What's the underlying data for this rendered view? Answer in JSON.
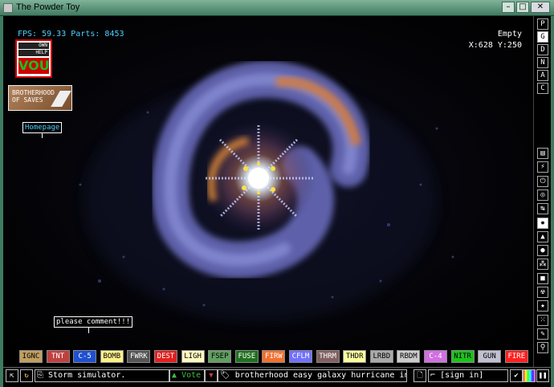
{
  "window": {
    "title": "The Powder Toy",
    "min_glyph": "–",
    "max_glyph": "□",
    "close_glyph": "✕"
  },
  "hud": {
    "fps_label": "FPS:",
    "fps_value": "59.33",
    "parts_label": "Parts:",
    "parts_value": "8453",
    "hover_element": "Empty",
    "coords": "X:628 Y:250"
  },
  "signs": {
    "homepage": "Homepage",
    "comment": "please comment!!!"
  },
  "vote_badge": {
    "line1": "OWN",
    "line2": "HELP",
    "line3": "VOU"
  },
  "brotherhood_logo": {
    "text": "BROTHERHOOD\nOF SAVES"
  },
  "right_toolbar": {
    "menu": [
      {
        "label": "P",
        "active": false
      },
      {
        "label": "G",
        "active": true
      },
      {
        "label": "D",
        "active": false
      },
      {
        "label": "N",
        "active": false
      },
      {
        "label": "A",
        "active": false
      },
      {
        "label": "C",
        "active": false
      }
    ],
    "categories": [
      {
        "icon": "walls-icon",
        "glyph": "▤"
      },
      {
        "icon": "electronics-icon",
        "glyph": "⚡"
      },
      {
        "icon": "powered-icon",
        "glyph": "⏻"
      },
      {
        "icon": "sensors-icon",
        "glyph": "◎"
      },
      {
        "icon": "force-icon",
        "glyph": "↹"
      },
      {
        "icon": "explosives-icon",
        "glyph": "✸",
        "active": true
      },
      {
        "icon": "gases-icon",
        "glyph": "▲"
      },
      {
        "icon": "liquids-icon",
        "glyph": "●"
      },
      {
        "icon": "powders-icon",
        "glyph": "⁂"
      },
      {
        "icon": "solids-icon",
        "glyph": "■"
      },
      {
        "icon": "radioactive-icon",
        "glyph": "☢"
      },
      {
        "icon": "special-icon",
        "glyph": "★"
      },
      {
        "icon": "life-icon",
        "glyph": "⁙"
      },
      {
        "icon": "tools-icon",
        "glyph": "✎"
      },
      {
        "icon": "search-icon",
        "glyph": "⚲"
      }
    ]
  },
  "elements": [
    {
      "name": "IGNC",
      "bg": "#c0a060",
      "fg": "#000"
    },
    {
      "name": "TNT",
      "bg": "#c04040",
      "fg": "#fff"
    },
    {
      "name": "C-5",
      "bg": "#2050d0",
      "fg": "#fff"
    },
    {
      "name": "BOMB",
      "bg": "#fff08a",
      "fg": "#000"
    },
    {
      "name": "FWRK",
      "bg": "#555555",
      "fg": "#fff"
    },
    {
      "name": "DEST",
      "bg": "#e02020",
      "fg": "#fff"
    },
    {
      "name": "LIGH",
      "bg": "#fffac0",
      "fg": "#000"
    },
    {
      "name": "FSEP",
      "bg": "#60a060",
      "fg": "#000"
    },
    {
      "name": "FUSE",
      "bg": "#207020",
      "fg": "#fff"
    },
    {
      "name": "FIRW",
      "bg": "#f07030",
      "fg": "#fff"
    },
    {
      "name": "CFLM",
      "bg": "#7070ff",
      "fg": "#fff"
    },
    {
      "name": "THRM",
      "bg": "#806060",
      "fg": "#fff"
    },
    {
      "name": "THDR",
      "bg": "#ffffa0",
      "fg": "#000"
    },
    {
      "name": "LRBD",
      "bg": "#aaaaaa",
      "fg": "#000"
    },
    {
      "name": "RBDM",
      "bg": "#cccccc",
      "fg": "#000"
    },
    {
      "name": "C-4",
      "bg": "#d070e0",
      "fg": "#fff"
    },
    {
      "name": "NITR",
      "bg": "#20c020",
      "fg": "#000"
    },
    {
      "name": "GUN",
      "bg": "#c0c0d0",
      "fg": "#000"
    },
    {
      "name": "FIRE",
      "bg": "#ff2020",
      "fg": "#fff"
    }
  ],
  "bottom_bar": {
    "open_glyph": "⇱",
    "reload_glyph": "↻",
    "save_glyph": "⎘",
    "save_name": "Storm simulator.",
    "vote_up_glyph": "▲",
    "vote_up_label": "Vote",
    "vote_down_glyph": "▼",
    "tag_glyph": "🏷",
    "tags": "brotherhood easy galaxy hurricane indas...",
    "new_glyph": "🗋",
    "login_glyph": "⌐",
    "login_label": "[sign in]",
    "settings_glyph": "✔",
    "pause_glyph": "❚❚"
  }
}
